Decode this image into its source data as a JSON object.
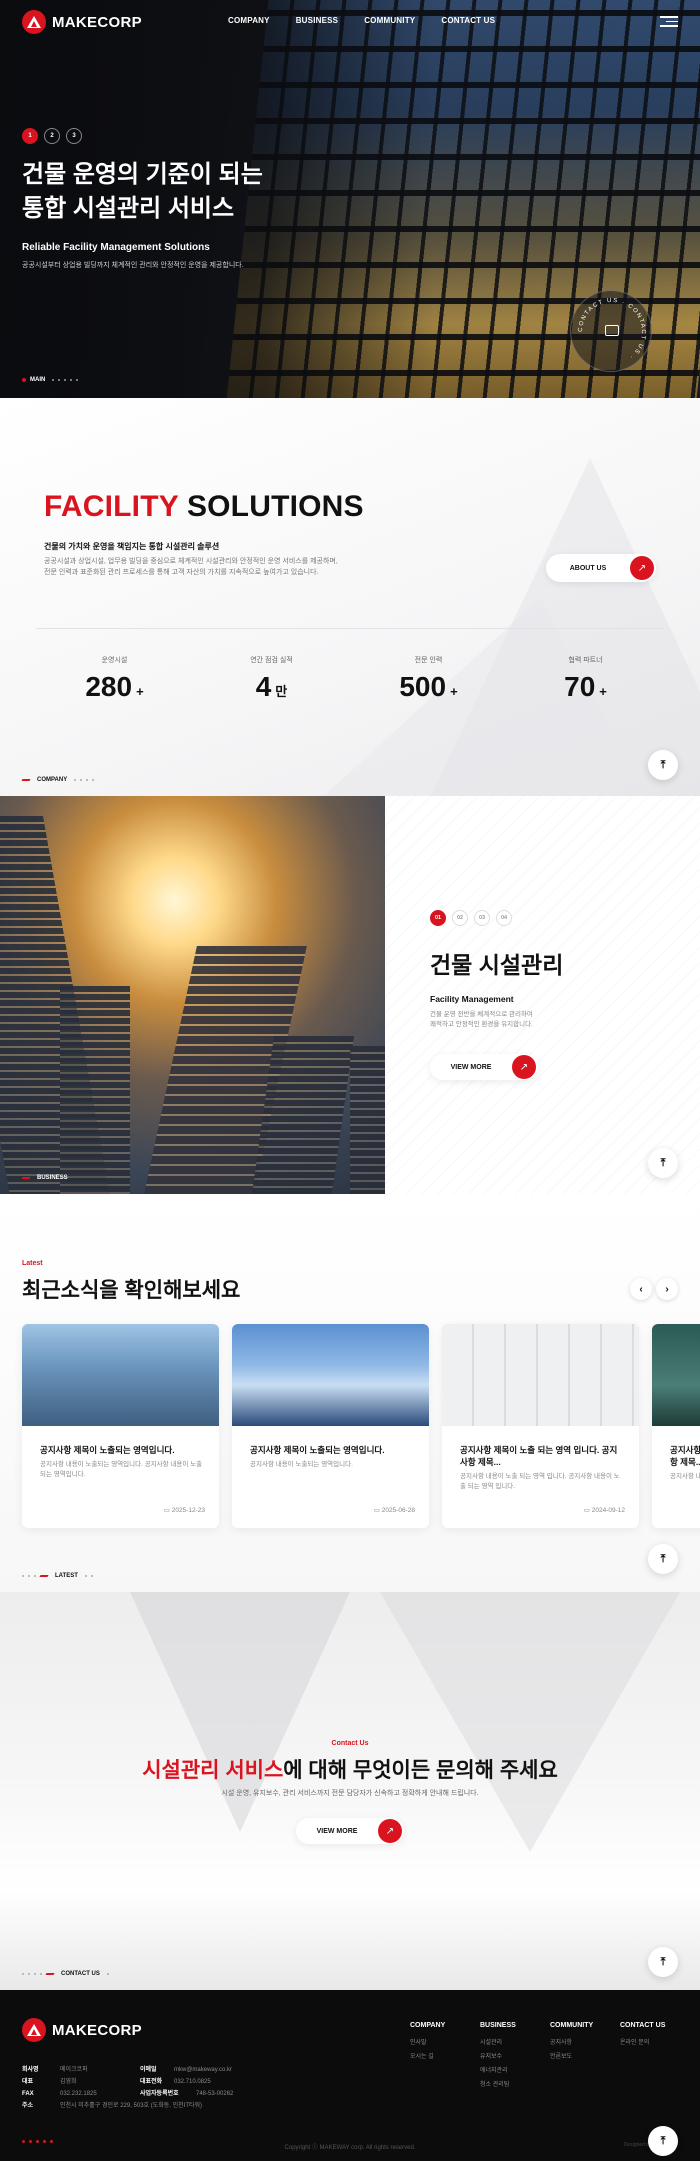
{
  "header": {
    "logo_text": "MAKECORP",
    "nav": [
      "COMPANY",
      "BUSINESS",
      "COMMUNITY",
      "CONTACT US"
    ]
  },
  "hero": {
    "slides": [
      "1",
      "2",
      "3"
    ],
    "title_line1": "건물 운영의 기준이 되는",
    "title_line2": "통합 시설관리 서비스",
    "subtitle": "Reliable Facility Management Solutions",
    "desc": "공공시설부터 상업용 빌딩까지 체계적인 관리와 안정적인 운영을 제공합니다.",
    "section_label": "MAIN",
    "contact_ring_text": "CONTACT US · CONTACT US ·"
  },
  "company": {
    "title_red": "FACILITY",
    "title_rest": "SOLUTIONS",
    "lead": "건물의 가치와 운영을 책임지는 통합 시설관리 솔루션",
    "body_line1": "공공시설과 상업시설, 업무용 빌딩을 중심으로 체계적인 시설관리와 안정적인 운영 서비스를 제공하며,",
    "body_line2": "전문 인력과 표준화된 관리 프로세스를 통해 고객 자산의 가치를 지속적으로 높여가고 있습니다.",
    "cta": "ABOUT US",
    "stats": [
      {
        "label": "운영시설",
        "value": "280",
        "unit": "+"
      },
      {
        "label": "연간 점검 실적",
        "value": "4",
        "unit": "만"
      },
      {
        "label": "전문 인력",
        "value": "500",
        "unit": "+"
      },
      {
        "label": "협력 파트너",
        "value": "70",
        "unit": "+"
      }
    ],
    "section_label": "COMPANY"
  },
  "business": {
    "pager": [
      "01",
      "02",
      "03",
      "04"
    ],
    "title": "건물 시설관리",
    "en_title": "Facility Management",
    "desc_line1": "건물 운영 전반을 체계적으로 관리하여",
    "desc_line2": "쾌적하고 안정적인 환경을 유지합니다.",
    "cta": "VIEW MORE",
    "section_label": "BUSINESS"
  },
  "latest": {
    "tag": "Latest",
    "title": "최근소식을 확인해보세요",
    "prev": "‹",
    "next": "›",
    "cards": [
      {
        "title": "공지사항 제목이 노출되는 영역입니다.",
        "text": "공지사항 내용이 노출되는 영역입니다. 공지사항 내용이 노출되는 영역입니다.",
        "date": "2025-12-23"
      },
      {
        "title": "공지사항 제목이 노출되는 영역입니다.",
        "text": "공지사항 내용이 노출되는 영역입니다.",
        "date": "2025-06-28"
      },
      {
        "title": "공지사항 제목이 노출 되는 영역 입니다. 공지사항 제목...",
        "text": "공지사항 내용이 노출 되는 영역 입니다. 공지사항 내용이 노출 되는 영역 입니다.",
        "date": "2024-09-12"
      },
      {
        "title": "공지사항 제목이 노출되는 영역입니다. 공지사항 제목...",
        "text": "공지사항 내용이 노출되는 영역입니다.",
        "date": ""
      }
    ],
    "section_label": "LATEST"
  },
  "contact": {
    "tag": "Contact Us",
    "title_red": "시설관리 서비스",
    "title_rest": "에 대해 무엇이든 문의해 주세요",
    "desc": "시설 운영, 유지보수, 관리 서비스까지 전문 담당자가 신속하고 정확하게 안내해 드립니다.",
    "cta": "VIEW MORE",
    "section_label": "CONTACT US"
  },
  "footer": {
    "columns": [
      {
        "title": "COMPANY",
        "items": [
          "인사말",
          "오시는 길"
        ]
      },
      {
        "title": "BUSINESS",
        "items": [
          "시설관리",
          "유지보수",
          "에너지관리",
          "청소 관리팀"
        ]
      },
      {
        "title": "COMMUNITY",
        "items": [
          "공지사항",
          "언론보도"
        ]
      },
      {
        "title": "CONTACT US",
        "items": [
          "온라인 문의"
        ]
      }
    ],
    "info": {
      "company_label": "회사명",
      "company": "메이크코퍼",
      "email_label": "이메일",
      "email": "mkw@makeway.co.kr",
      "ceo_label": "대표",
      "ceo": "김영희",
      "tel_label": "대표전화",
      "tel": "032.710.0825",
      "fax_label": "FAX",
      "fax": "032.232.1825",
      "biz_label": "사업자등록번호",
      "biz": "748-53-00262",
      "addr_label": "주소",
      "addr": "인천시 미추홀구 경인로 229, 503호 (도화동, 인천IT타워)"
    },
    "copyright": "Copyright ⓒ MAKEWAY corp. All rights reserved.",
    "designed": "Designed by MAKEWAY"
  },
  "colors": {
    "accent": "#d9141f",
    "dark": "#111111"
  },
  "icons": [
    "hamburger-icon",
    "chat-icon",
    "arrow-up-right-icon",
    "arrow-to-top-icon",
    "calendar-icon",
    "chevron-left-icon",
    "chevron-right-icon"
  ]
}
